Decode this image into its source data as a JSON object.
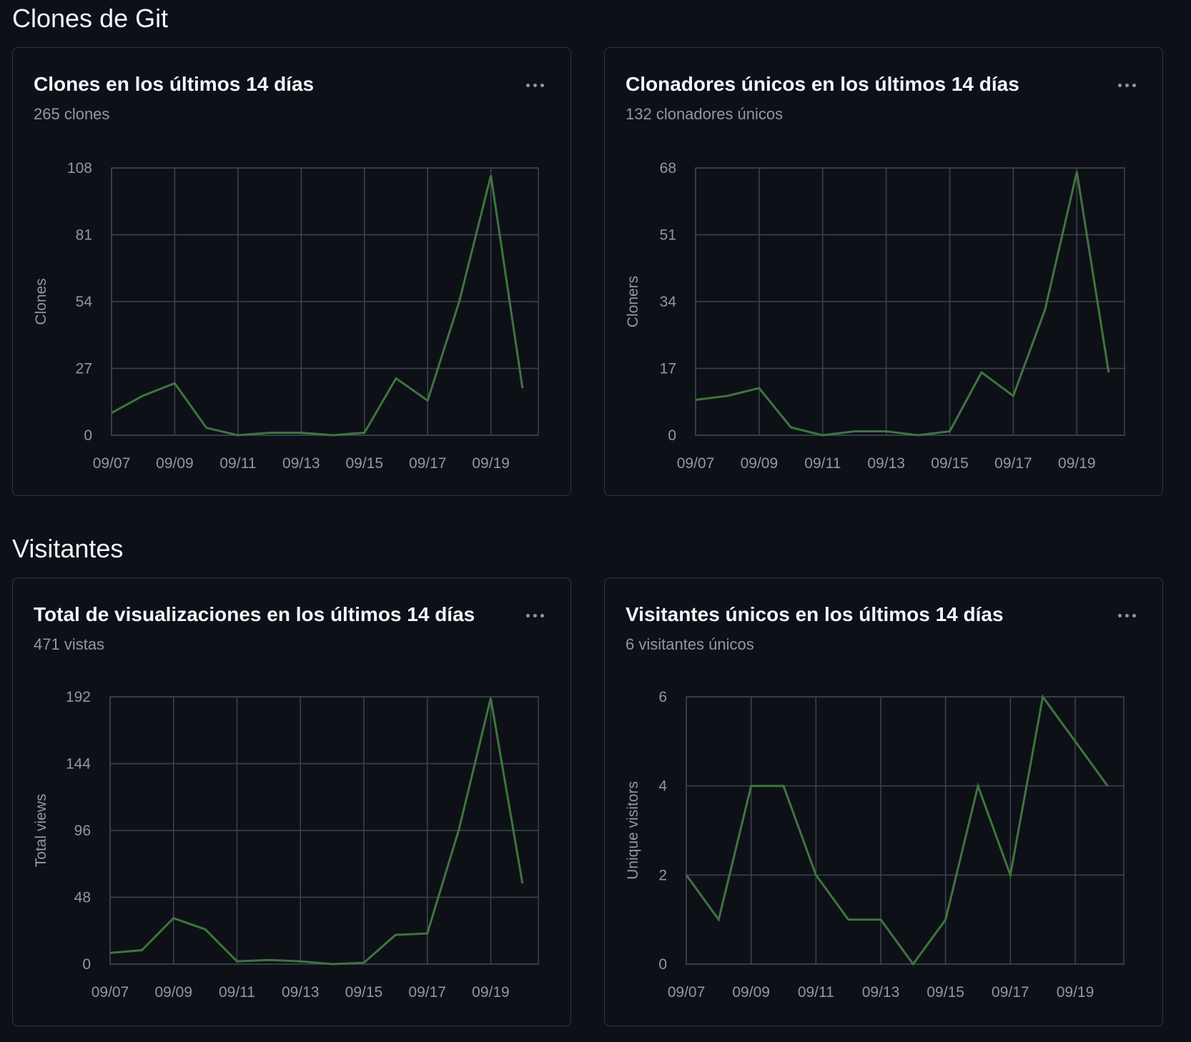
{
  "sections": {
    "clones_title": "Clones de Git",
    "visitors_title": "Visitantes"
  },
  "colors": {
    "background": "#0d1117",
    "border": "#30363d",
    "grid": "#3d444d",
    "line": "#3f7440",
    "text_muted": "#9198a1"
  },
  "icons": {
    "menu": "kebab-horizontal-icon"
  },
  "cards": [
    {
      "title": "Clones en los últimos 14 días",
      "subtitle": "265 clones",
      "chart_data": {
        "type": "line",
        "ylabel": "Clones",
        "ylim": [
          0,
          108
        ],
        "yticks": [
          "0",
          "27",
          "54",
          "81",
          "108"
        ],
        "xticks": [
          "09/07",
          "09/09",
          "09/11",
          "09/13",
          "09/15",
          "09/17",
          "09/19"
        ],
        "x": [
          "09/07",
          "09/08",
          "09/09",
          "09/10",
          "09/11",
          "09/12",
          "09/13",
          "09/14",
          "09/15",
          "09/16",
          "09/17",
          "09/18",
          "09/19",
          "09/20"
        ],
        "series": [
          {
            "values": [
              9,
              16,
              21,
              3,
              0,
              1,
              1,
              0,
              1,
              23,
              14,
              54,
              105,
              19
            ]
          }
        ]
      }
    },
    {
      "title": "Clonadores únicos en los últimos 14 días",
      "subtitle": "132 clonadores únicos",
      "chart_data": {
        "type": "line",
        "ylabel": "Cloners",
        "ylim": [
          0,
          68
        ],
        "yticks": [
          "0",
          "17",
          "34",
          "51",
          "68"
        ],
        "xticks": [
          "09/07",
          "09/09",
          "09/11",
          "09/13",
          "09/15",
          "09/17",
          "09/19"
        ],
        "x": [
          "09/07",
          "09/08",
          "09/09",
          "09/10",
          "09/11",
          "09/12",
          "09/13",
          "09/14",
          "09/15",
          "09/16",
          "09/17",
          "09/18",
          "09/19",
          "09/20"
        ],
        "series": [
          {
            "values": [
              9,
              10,
              12,
              2,
              0,
              1,
              1,
              0,
              1,
              16,
              10,
              32,
              67,
              16
            ]
          }
        ]
      }
    },
    {
      "title": "Total de visualizaciones en los últimos 14 días",
      "subtitle": "471 vistas",
      "chart_data": {
        "type": "line",
        "ylabel": "Total views",
        "ylim": [
          0,
          192
        ],
        "yticks": [
          "0",
          "48",
          "96",
          "144",
          "192"
        ],
        "xticks": [
          "09/07",
          "09/09",
          "09/11",
          "09/13",
          "09/15",
          "09/17",
          "09/19"
        ],
        "x": [
          "09/07",
          "09/08",
          "09/09",
          "09/10",
          "09/11",
          "09/12",
          "09/13",
          "09/14",
          "09/15",
          "09/16",
          "09/17",
          "09/18",
          "09/19",
          "09/20"
        ],
        "series": [
          {
            "values": [
              8,
              10,
              33,
              25,
              2,
              3,
              2,
              0,
              1,
              21,
              22,
              97,
              191,
              58
            ]
          }
        ]
      }
    },
    {
      "title": "Visitantes únicos en los últimos 14 días",
      "subtitle": "6 visitantes únicos",
      "chart_data": {
        "type": "line",
        "ylabel": "Unique visitors",
        "ylim": [
          0,
          6
        ],
        "yticks": [
          "0",
          "2",
          "4",
          "6"
        ],
        "xticks": [
          "09/07",
          "09/09",
          "09/11",
          "09/13",
          "09/15",
          "09/17",
          "09/19"
        ],
        "x": [
          "09/07",
          "09/08",
          "09/09",
          "09/10",
          "09/11",
          "09/12",
          "09/13",
          "09/14",
          "09/15",
          "09/16",
          "09/17",
          "09/18",
          "09/19",
          "09/20"
        ],
        "series": [
          {
            "values": [
              2,
              1,
              4,
              4,
              2,
              1,
              1,
              0,
              1,
              4,
              2,
              6,
              5,
              4
            ]
          }
        ]
      }
    }
  ]
}
